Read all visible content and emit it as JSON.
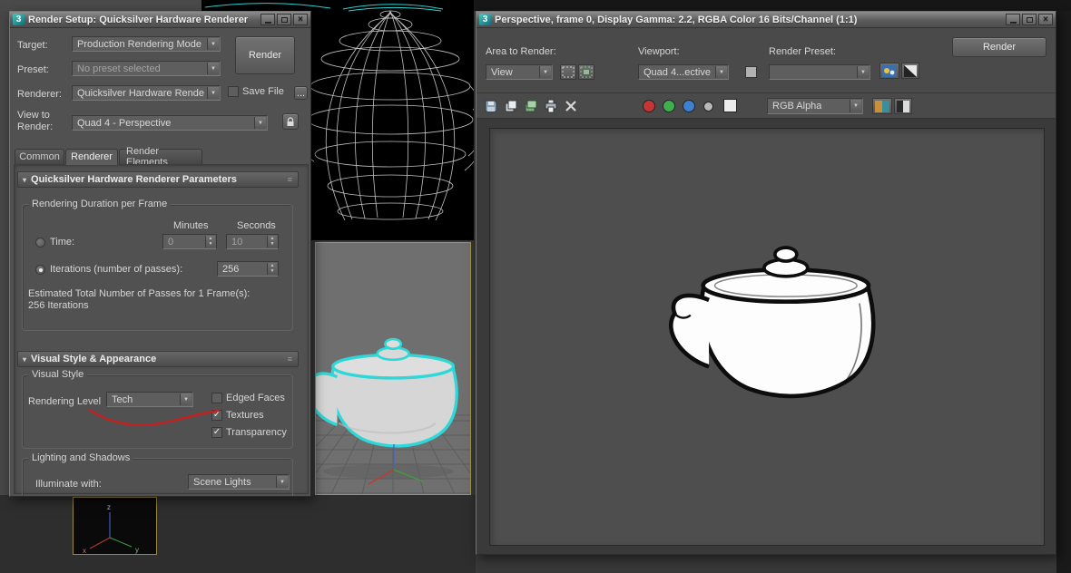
{
  "gizmo": {
    "x": "x",
    "y": "y",
    "z": "z"
  },
  "colors": {
    "selection_cyan": "#2fd8d8",
    "annotation_red": "#c62020",
    "active_viewport_border": "#a3954a"
  },
  "render_setup": {
    "logo": "3",
    "title": "Render Setup: Quicksilver Hardware Renderer",
    "target_label": "Target:",
    "target_value": "Production Rendering Mode",
    "preset_label": "Preset:",
    "preset_value": "No preset selected",
    "renderer_label": "Renderer:",
    "renderer_value": "Quicksilver Hardware Renderer",
    "save_file_label": "Save File",
    "save_file_checked": false,
    "browse_button": "...",
    "view_to_render_label": "View to Render:",
    "view_to_render_value": "Quad 4 - Perspective",
    "render_button": "Render",
    "tabs": [
      "Common",
      "Renderer",
      "Render Elements"
    ],
    "params": {
      "rollout_title": "Quicksilver Hardware Renderer Parameters",
      "duration_group": "Rendering Duration per Frame",
      "minutes_header": "Minutes",
      "seconds_header": "Seconds",
      "time_label": "Time:",
      "time_radio": false,
      "time_minutes": "0",
      "time_seconds": "10",
      "iterations_label": "Iterations (number of passes):",
      "iterations_radio": true,
      "iterations_value": "256",
      "estimated_line1": "Estimated Total Number of Passes for 1 Frame(s):",
      "estimated_line2": "256 Iterations"
    },
    "visual": {
      "rollout_title": "Visual Style & Appearance",
      "style_group": "Visual Style",
      "rendering_level_label": "Rendering Level",
      "rendering_level_value": "Tech",
      "edged_faces_label": "Edged Faces",
      "edged_faces_checked": false,
      "textures_label": "Textures",
      "textures_checked": true,
      "transparency_label": "Transparency",
      "transparency_checked": true,
      "lighting_group": "Lighting and Shadows",
      "illuminate_label": "Illuminate with:",
      "illuminate_value": "Scene Lights"
    }
  },
  "frame_window": {
    "logo": "3",
    "title": "Perspective, frame 0, Display Gamma: 2.2, RGBA Color 16 Bits/Channel (1:1)",
    "area_to_render_label": "Area to Render:",
    "area_to_render_value": "View",
    "viewport_label": "Viewport:",
    "viewport_value": "Quad 4...ective",
    "render_preset_label": "Render Preset:",
    "render_preset_value": "",
    "channel_display_value": "RGB Alpha",
    "render_button": "Render"
  }
}
